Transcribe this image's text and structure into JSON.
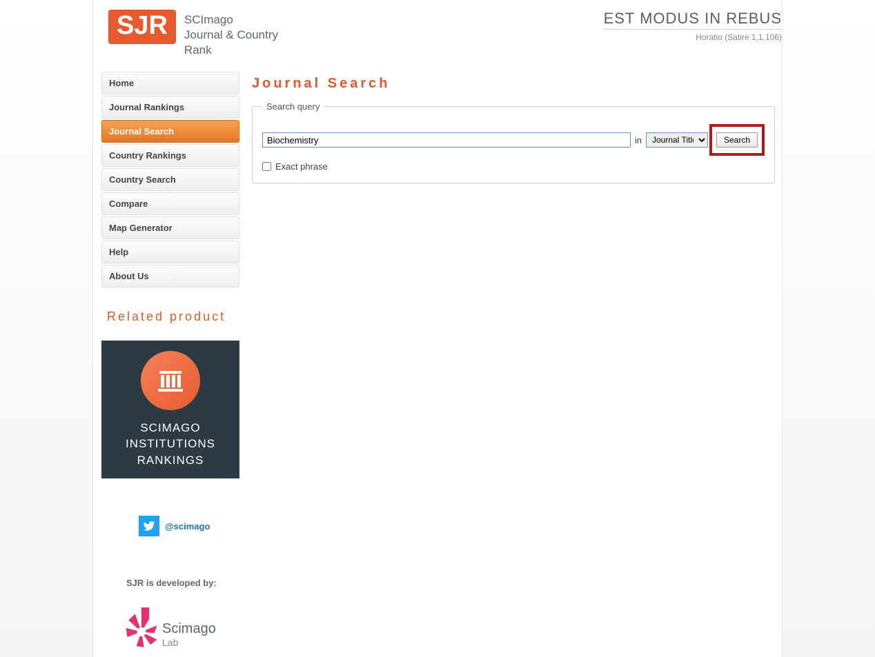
{
  "header": {
    "logo_abbr": "SJR",
    "logo_line1": "SCImago",
    "logo_line2": "Journal & Country",
    "logo_line3": "Rank",
    "tagline_main": "EST MODUS IN REBUS",
    "tagline_sub": "Horatio (Satire 1,1,106)"
  },
  "nav": {
    "items": [
      {
        "label": "Home",
        "active": false
      },
      {
        "label": "Journal Rankings",
        "active": false
      },
      {
        "label": "Journal Search",
        "active": true
      },
      {
        "label": "Country Rankings",
        "active": false
      },
      {
        "label": "Country Search",
        "active": false
      },
      {
        "label": "Compare",
        "active": false
      },
      {
        "label": "Map Generator",
        "active": false
      },
      {
        "label": "Help",
        "active": false
      },
      {
        "label": "About Us",
        "active": false
      }
    ]
  },
  "related": {
    "title": "Related product",
    "card_line1": "SCIMAGO",
    "card_line2": "INSTITUTIONS",
    "card_line3": "RANKINGS"
  },
  "twitter": {
    "handle": "@scimago"
  },
  "developed_by": "SJR is developed by:",
  "lab": {
    "name": "Scimago",
    "sub": "Lab"
  },
  "main": {
    "page_title": "Journal Search",
    "legend": "Search query",
    "search_value": "Biochemistry",
    "in_label": "in",
    "select_value": "Journal Title",
    "search_button": "Search",
    "exact_label": "Exact phrase"
  }
}
